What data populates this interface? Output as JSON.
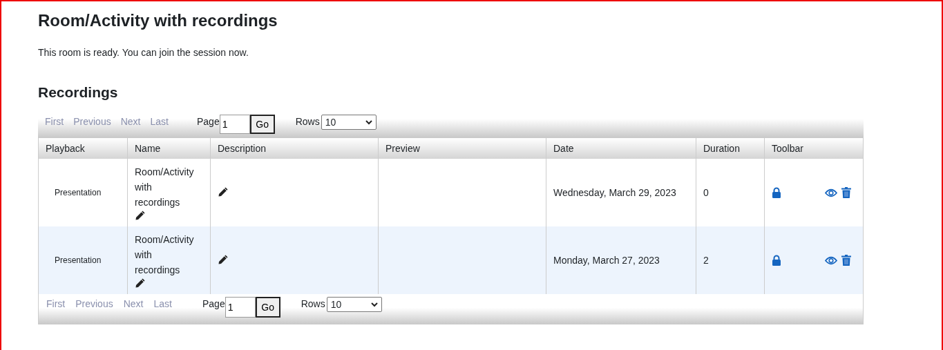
{
  "title": "Room/Activity with recordings",
  "status_message": "This room is ready. You can join the session now.",
  "recordings": {
    "heading": "Recordings",
    "pager_top": {
      "links": [
        {
          "label": "First",
          "disabled": true
        },
        {
          "label": "Previous",
          "disabled": true
        },
        {
          "label": "Next",
          "disabled": true
        },
        {
          "label": "Last",
          "disabled": true
        }
      ],
      "page_label": "Page",
      "page_value": "1",
      "go_label": "Go",
      "rows_label": "Rows",
      "rows_value": "10"
    },
    "columns": [
      "Playback",
      "Name",
      "Description",
      "Preview",
      "Date",
      "Duration",
      "Toolbar"
    ],
    "rows": [
      {
        "playback": "Presentation",
        "name": "Room/Activity with recordings",
        "date": "Wednesday, March 29, 2023",
        "duration": "0"
      },
      {
        "playback": "Presentation",
        "name": "Room/Activity with recordings",
        "date": "Monday, March 27, 2023",
        "duration": "2"
      }
    ],
    "pager_bottom": {
      "links": [
        {
          "label": "First",
          "disabled": true
        },
        {
          "label": "Previous",
          "disabled": true
        },
        {
          "label": "Next",
          "disabled": true
        },
        {
          "label": "Last",
          "disabled": true
        }
      ],
      "page_label": "Page",
      "page_value": "1",
      "go_label": "Go",
      "rows_label": "Rows",
      "rows_value": "10"
    }
  }
}
